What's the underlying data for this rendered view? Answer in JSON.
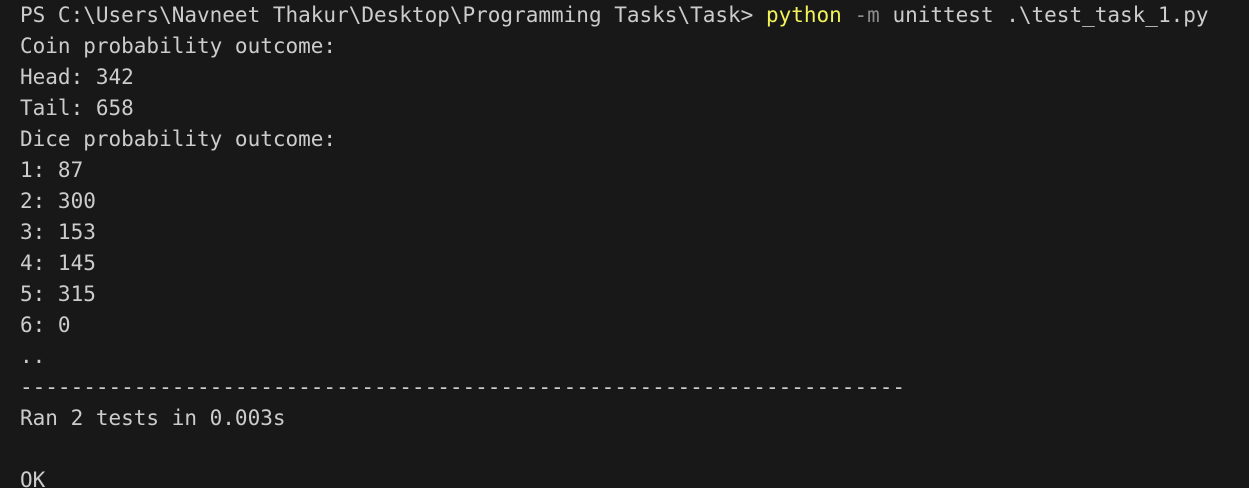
{
  "terminal": {
    "prompt": "PS C:\\Users\\Navneet Thakur\\Desktop\\Programming Tasks\\Task>",
    "command_program": "python",
    "command_flag": "-m",
    "command_args": "unittest .\\test_task_1.py",
    "output": [
      "Coin probability outcome:",
      "Head: 342",
      "Tail: 658",
      "Dice probability outcome:",
      "1: 87",
      "2: 300",
      "3: 153",
      "4: 145",
      "5: 315",
      "6: 0",
      "..",
      "----------------------------------------------------------------------",
      "Ran 2 tests in 0.003s",
      "",
      "OK"
    ]
  },
  "colors": {
    "background": "#181818",
    "text": "#cccccc",
    "command": "#f2f25a",
    "flag": "#8a8a8a"
  }
}
